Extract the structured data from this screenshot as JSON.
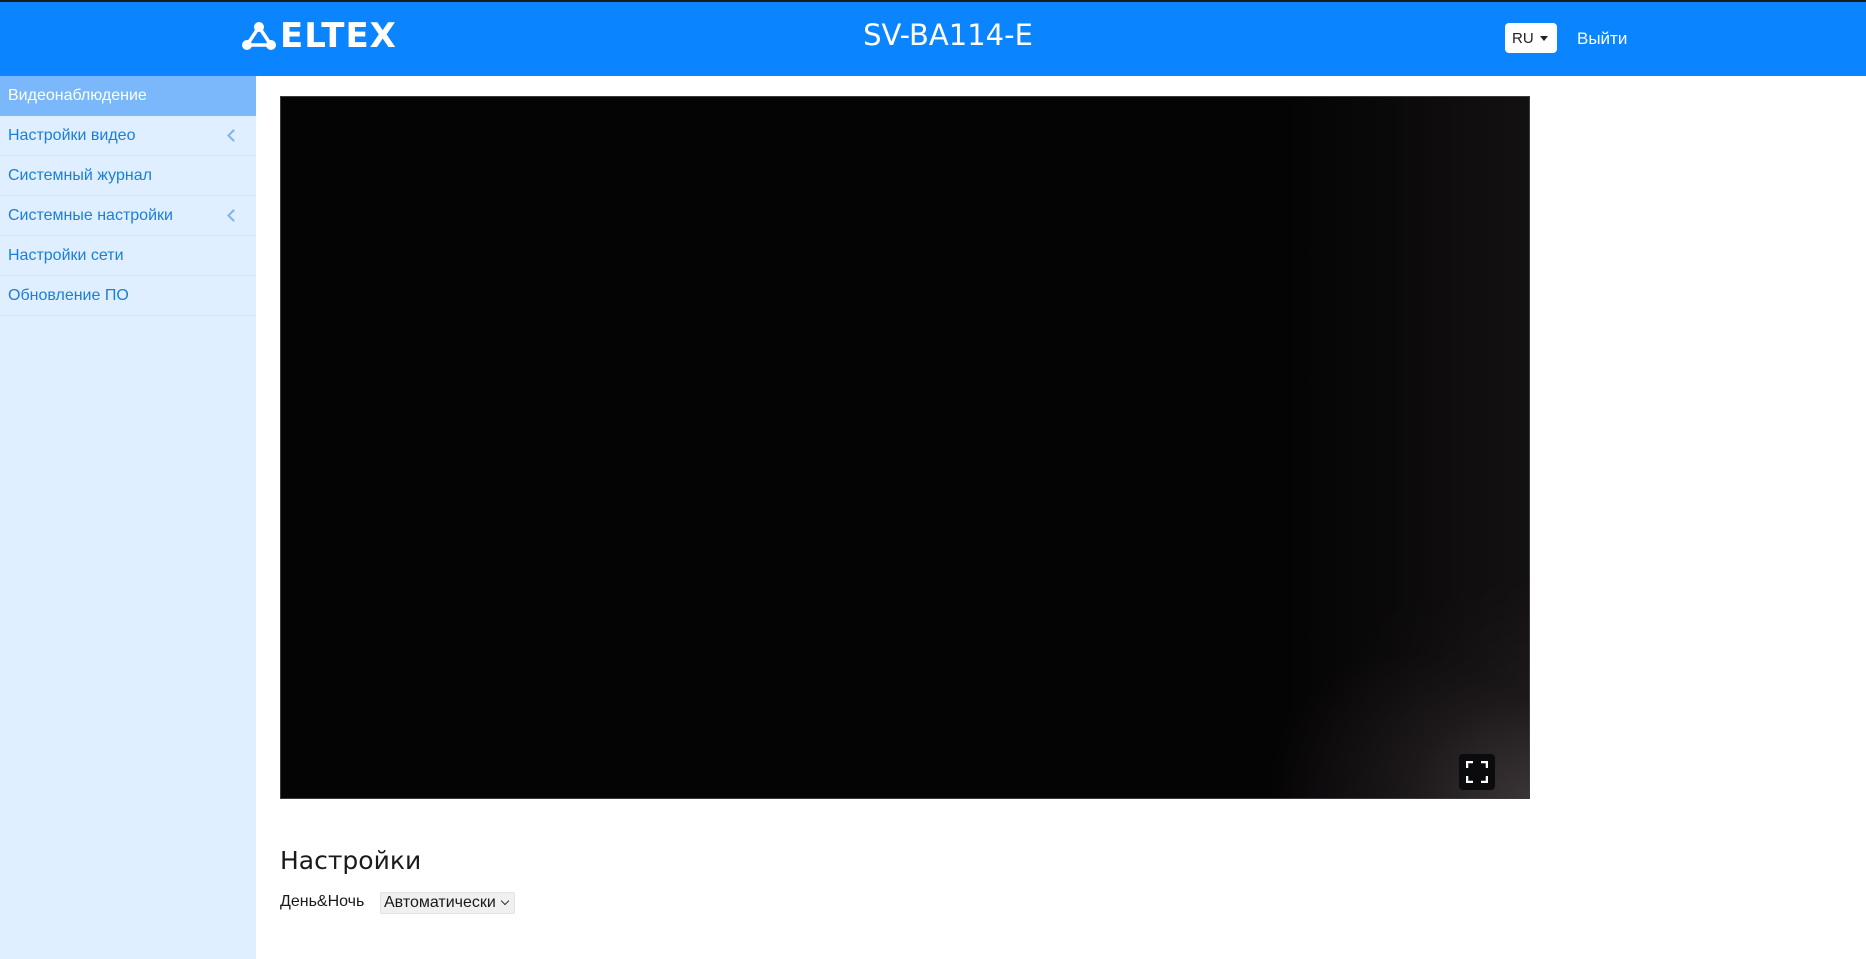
{
  "header": {
    "logo_text": "ELTEX",
    "device_title": "SV-BA114-E",
    "language": "RU",
    "logout_label": "Выйти",
    "background_color": "#0a84ff"
  },
  "sidebar": {
    "items": [
      {
        "label": "Видеонаблюдение",
        "active": true,
        "has_submenu": false
      },
      {
        "label": "Настройки видео",
        "active": false,
        "has_submenu": true
      },
      {
        "label": "Системный журнал",
        "active": false,
        "has_submenu": false
      },
      {
        "label": "Системные настройки",
        "active": false,
        "has_submenu": true
      },
      {
        "label": "Настройки сети",
        "active": false,
        "has_submenu": false
      },
      {
        "label": "Обновление ПО",
        "active": false,
        "has_submenu": false
      }
    ]
  },
  "video": {
    "fullscreen_icon": "fullscreen-icon"
  },
  "settings": {
    "title": "Настройки",
    "day_night_label": "День&Ночь",
    "day_night_value": "Автоматически"
  }
}
